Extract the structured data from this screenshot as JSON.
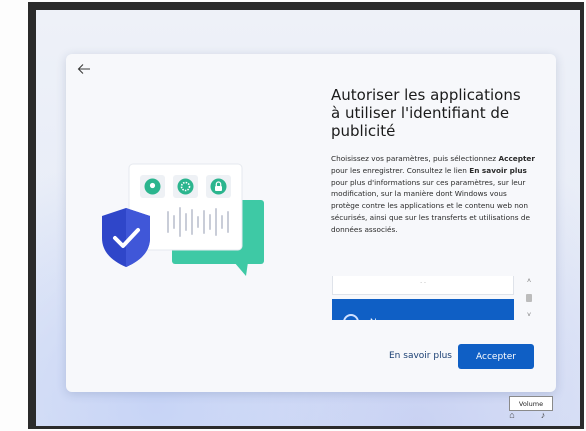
{
  "dialog": {
    "title": "Autoriser les applications à utiliser l'identifiant de publicité",
    "description": {
      "part1": "Choisissez vos paramètres, puis sélectionnez ",
      "accept_word": "Accepter",
      "part2": " pour les enregistrer. Consultez le lien ",
      "learn_word": "En savoir plus",
      "part3": " pour plus d'informations sur ces paramètres, sur leur modification, sur la manière dont Windows vous protège contre les applications et le contenu web non sécurisés, ainsi que sur les transferts et utilisations de données associés."
    },
    "options": {
      "selected_label": "N"
    },
    "learn_more_label": "En savoir plus",
    "accept_label": "Accepter"
  },
  "taskbar": {
    "tooltip": "Volume"
  },
  "icons": [
    "back-arrow-icon",
    "shield-check-icon",
    "location-icon",
    "settings-icon",
    "lock-icon",
    "chat-bubble-icon",
    "audio-wave-icon",
    "radio-ring-icon",
    "chevron-up-icon",
    "chevron-down-icon",
    "network-icon",
    "volume-icon"
  ],
  "colors": {
    "accent": "#0f5fc5",
    "shield": "#2f46c9",
    "bubble": "#3ec9a5",
    "dialog_bg": "#f7f8fb"
  }
}
